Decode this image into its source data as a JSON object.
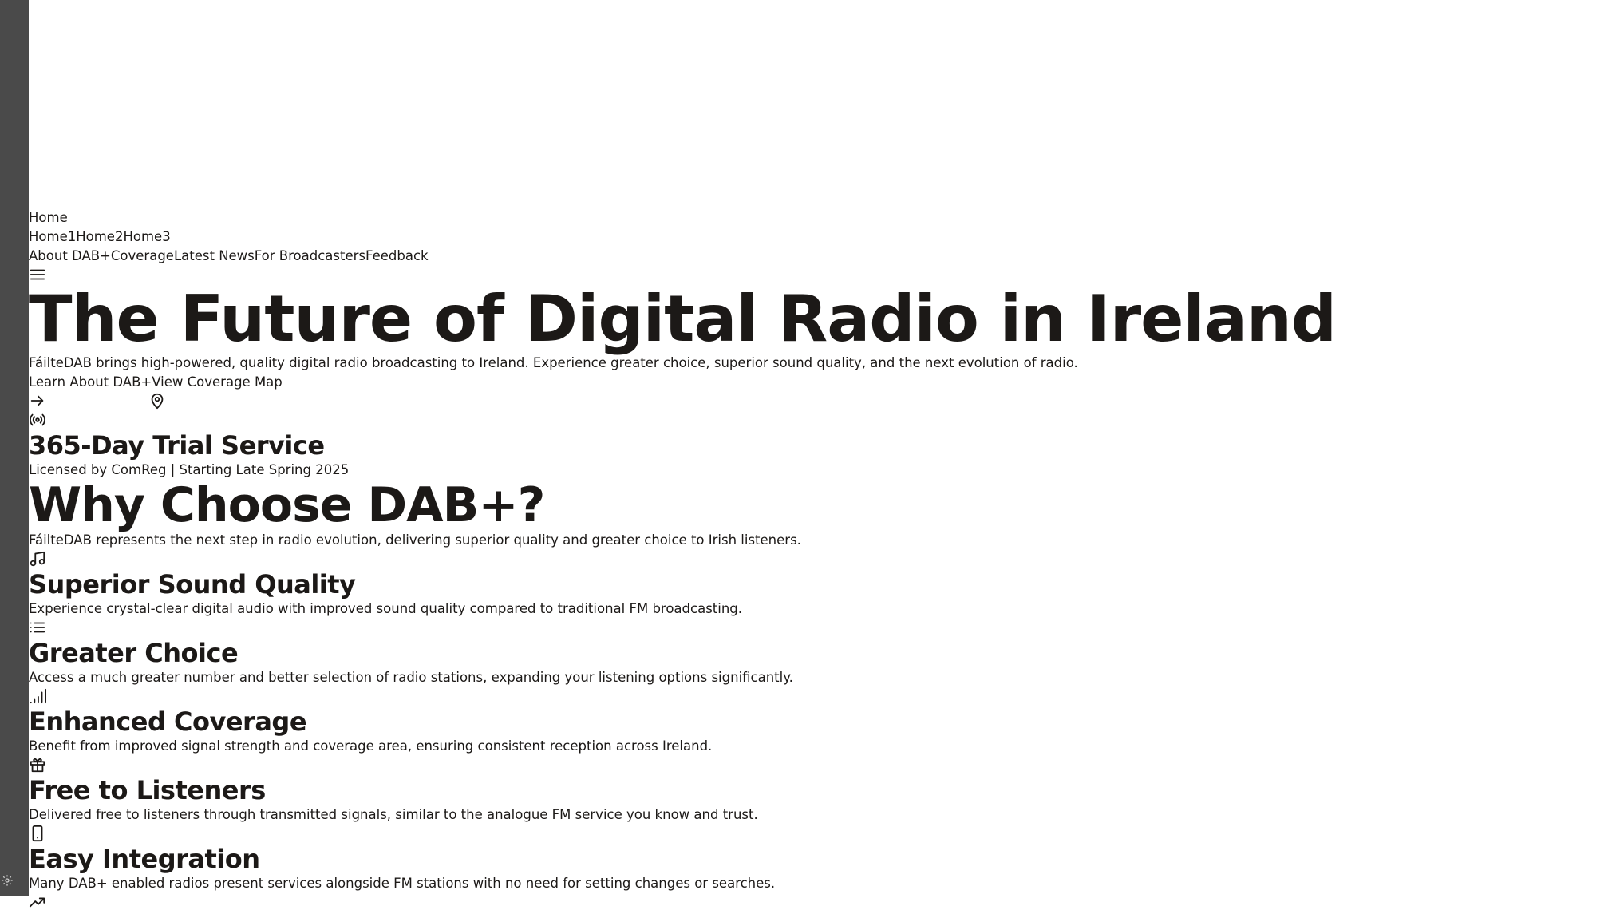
{
  "nav": {
    "home": "Home",
    "home_sub": [
      "Home1",
      "Home2",
      "Home3"
    ],
    "main": [
      "About DAB+",
      "Coverage",
      "Latest News",
      "For Broadcasters",
      "Feedback"
    ],
    "menu_icon": "menu-icon"
  },
  "hero": {
    "title": "The Future of Digital Radio in Ireland",
    "subtitle": "FáilteDAB brings high-powered, quality digital radio broadcasting to Ireland. Experience greater choice, superior sound quality, and the next evolution of radio.",
    "primary_button": "Learn About DAB+",
    "secondary_button": "View Coverage Map",
    "primary_icon": "arrow-right-icon",
    "secondary_icon": "map-pin-icon"
  },
  "trial": {
    "icon": "radio-broadcast-icon",
    "title": "365-Day Trial Service",
    "subtitle": "Licensed by ComReg | Starting Late Spring 2025"
  },
  "why": {
    "title": "Why Choose DAB+?",
    "subtitle": "FáilteDAB represents the next step in radio evolution, delivering superior quality and greater choice to Irish listeners."
  },
  "features": [
    {
      "icon": "music-icon",
      "title": "Superior Sound Quality",
      "text": "Experience crystal-clear digital audio with improved sound quality compared to traditional FM broadcasting."
    },
    {
      "icon": "list-icon",
      "title": "Greater Choice",
      "text": "Access a much greater number and better selection of radio stations, expanding your listening options significantly."
    },
    {
      "icon": "signal-bars-icon",
      "title": "Enhanced Coverage",
      "text": "Benefit from improved signal strength and coverage area, ensuring consistent reception across Ireland."
    },
    {
      "icon": "gift-icon",
      "title": "Free to Listeners",
      "text": "Delivered free to listeners through transmitted signals, similar to the analogue FM service you know and trust."
    },
    {
      "icon": "smartphone-icon",
      "title": "Easy Integration",
      "text": "Many DAB+ enabled radios present services alongside FM stations with no need for setting changes or searches."
    }
  ],
  "trailing_icon": "trending-up-icon",
  "sidebar": {
    "settings_icon": "gear-icon"
  },
  "colors": {
    "sidebar": "#4a4a4a",
    "text": "#1c1917",
    "background": "#ffffff"
  }
}
